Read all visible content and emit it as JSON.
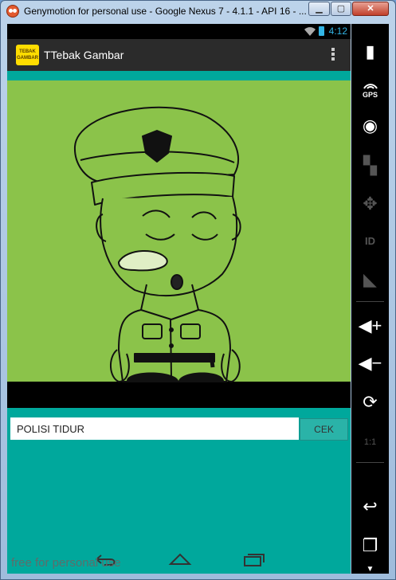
{
  "window": {
    "title": "Genymotion for personal use - Google Nexus 7 - 4.1.1 - API 16 - ..."
  },
  "statusbar": {
    "time": "4:12"
  },
  "actionbar": {
    "logo_text": "TEBAK GAMBAR",
    "title": "TTebak Gambar"
  },
  "quiz": {
    "answer_value": "POLISI TIDUR",
    "check_label": "CEK"
  },
  "overlay": {
    "watermark": "free for personal use"
  },
  "sidebar": {
    "gps_label": "GPS",
    "id_label": "ID",
    "scale_label": "1:1"
  },
  "colors": {
    "app_background": "#00a89c",
    "picture_background": "#8bc34a",
    "action_bar": "#2b2b2b",
    "accent": "#33b5e5"
  }
}
